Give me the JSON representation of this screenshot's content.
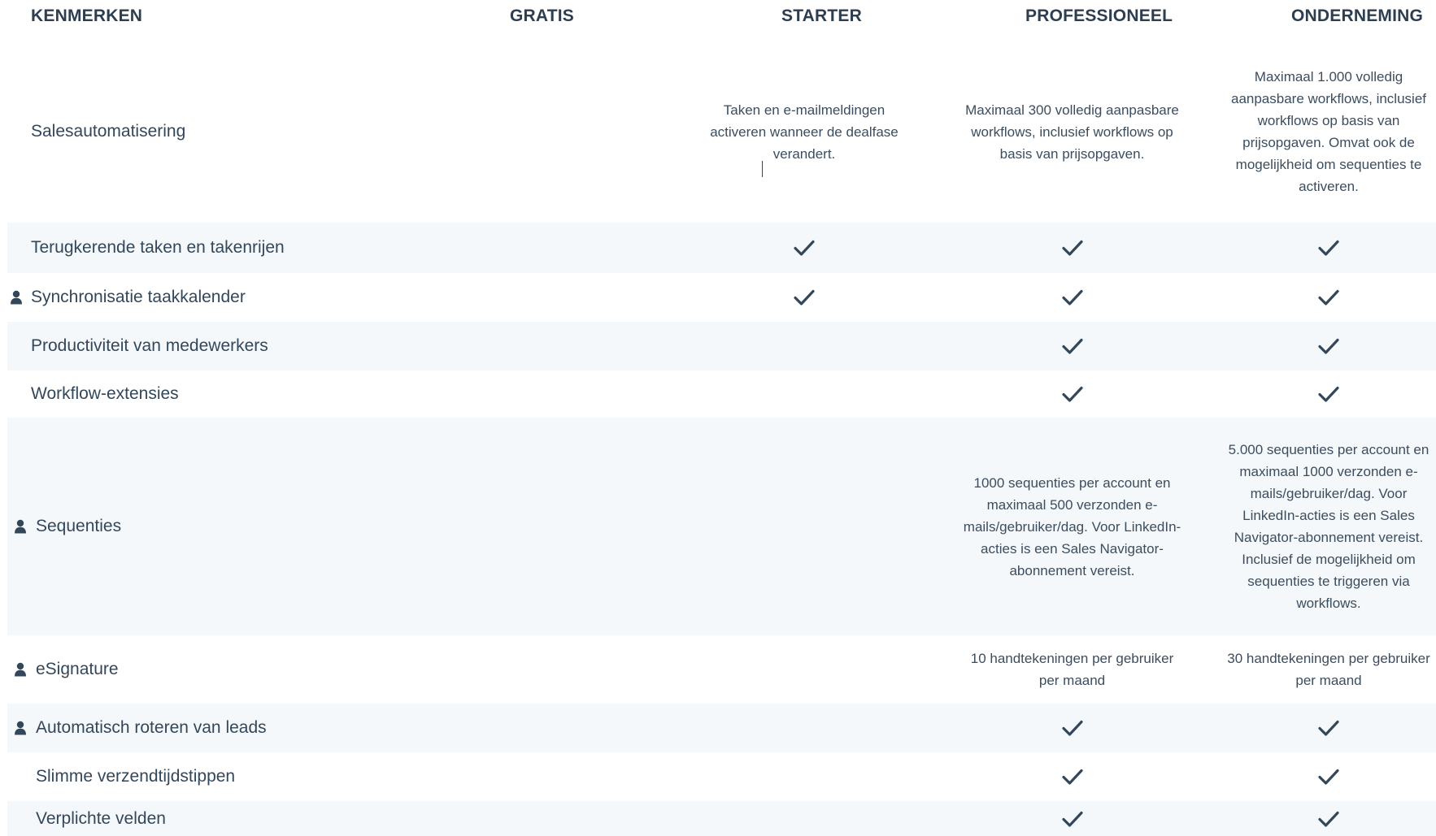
{
  "header": {
    "features": "KENMERKEN",
    "free": "GRATIS",
    "starter": "STARTER",
    "professional": "PROFESSIONEEL",
    "enterprise": "ONDERNEMING"
  },
  "rows": [
    {
      "label": "Salesautomatisering",
      "icon": "",
      "starter": "Taken en e-mailmeldingen activeren wanneer de dealfase verandert.",
      "professional": "Maximaal 300 volledig aanpasbare workflows, inclusief workflows op basis van prijsopgaven.",
      "enterprise": "Maximaal 1.000 volledig aanpasbare workflows, inclusief workflows op basis van prijsopgaven. Omvat ook de mogelijkheid om sequenties te activeren."
    },
    {
      "label": "Terugkerende taken en takenrijen",
      "icon": "",
      "starter": "check-icon",
      "professional": "check-icon",
      "enterprise": "check-icon"
    },
    {
      "label": "Synchronisatie taakkalender",
      "icon": "person-icon",
      "starter": "check-icon",
      "professional": "check-icon",
      "enterprise": "check-icon"
    },
    {
      "label": "Productiviteit van medewerkers",
      "icon": "",
      "professional": "check-icon",
      "enterprise": "check-icon"
    },
    {
      "label": "Workflow-extensies",
      "icon": "",
      "professional": "check-icon",
      "enterprise": "check-icon"
    },
    {
      "label": "Sequenties",
      "icon": "person-icon",
      "professional": "1000 sequenties per account en maximaal 500 verzonden e-mails/gebruiker/dag. Voor LinkedIn-acties is een Sales Navigator-abonnement vereist.",
      "enterprise": "5.000 sequenties per account en maximaal 1000 verzonden e-mails/gebruiker/dag. Voor LinkedIn-acties is een Sales Navigator-abonnement vereist. Inclusief de mogelijkheid om sequenties te triggeren via workflows."
    },
    {
      "label": "eSignature",
      "icon": "person-icon",
      "professional": "10 handtekeningen per gebruiker per maand",
      "enterprise": "30 handtekeningen per gebruiker per maand"
    },
    {
      "label": "Automatisch roteren van leads",
      "icon": "person-icon",
      "professional": "check-icon",
      "enterprise": "check-icon"
    },
    {
      "label": "Slimme verzendtijdstippen",
      "icon": "",
      "professional": "check-icon",
      "enterprise": "check-icon"
    },
    {
      "label": "Verplichte velden",
      "icon": "",
      "professional": "check-icon",
      "enterprise": "check-icon"
    }
  ]
}
